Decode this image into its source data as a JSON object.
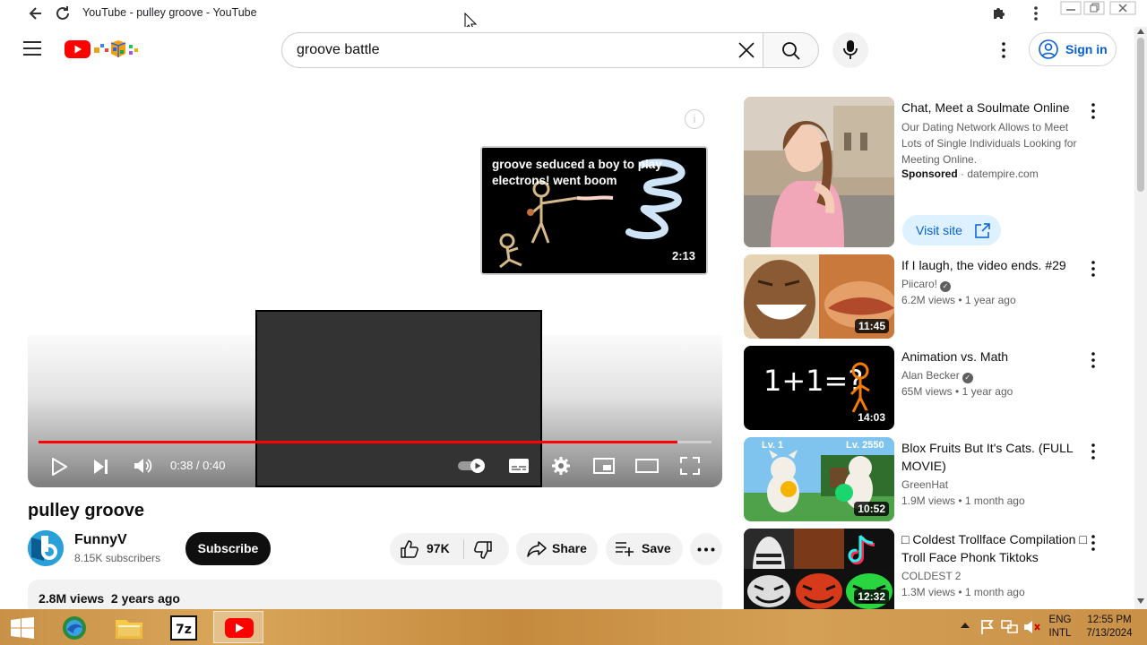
{
  "browser": {
    "tab_title": "YouTube - pulley groove - YouTube"
  },
  "header": {
    "search_value": "groove battle",
    "sign_in_label": "Sign in"
  },
  "player": {
    "endcard_title": "groove seduced a boy to play electrons! went boom",
    "endcard_duration": "2:13",
    "time": "0:38 / 0:40",
    "progress": 0.95
  },
  "video": {
    "title": "pulley groove",
    "channel": "FunnyV",
    "subscribers": "8.15K subscribers",
    "subscribe_label": "Subscribe",
    "likes": "97K",
    "share_label": "Share",
    "save_label": "Save",
    "stats": "2.8M views  2 years ago"
  },
  "sidebar": {
    "items": [
      {
        "title": "Chat, Meet a Soulmate Online",
        "description": "Our Dating Network Allows to Meet Lots of Single Individuals Looking for Meeting Online.",
        "sponsored": "Sponsored",
        "domain": "datempire.com",
        "cta": "Visit site"
      },
      {
        "title": "If I laugh, the video ends. #29",
        "channel": "Piicaro!",
        "views": "6.2M views",
        "age": "1 year ago",
        "duration": "11:45"
      },
      {
        "title": "Animation vs. Math",
        "channel": "Alan Becker",
        "views": "65M views",
        "age": "1 year ago",
        "duration": "14:03",
        "thumb_text": "1+1=?"
      },
      {
        "title": "Blox Fruits But It's Cats. (FULL MOVIE)",
        "channel": "GreenHat",
        "views": "1.9M views",
        "age": "1 month ago",
        "duration": "10:52",
        "thumb_label_left": "Lv. 1",
        "thumb_label_right": "Lv. 2550"
      },
      {
        "title": "□ Coldest Trollface Compilation □ Troll Face Phonk Tiktoks",
        "channel": "COLDEST 2",
        "views": "1.3M views",
        "age": "1 month ago",
        "duration": "12:32"
      }
    ]
  },
  "taskbar": {
    "lang_top": "ENG",
    "lang_bottom": "INTL",
    "time": "12:55 PM",
    "date": "7/13/2024"
  },
  "colors": {
    "youtube_red": "#ff0000",
    "link_blue": "#065fd4"
  }
}
